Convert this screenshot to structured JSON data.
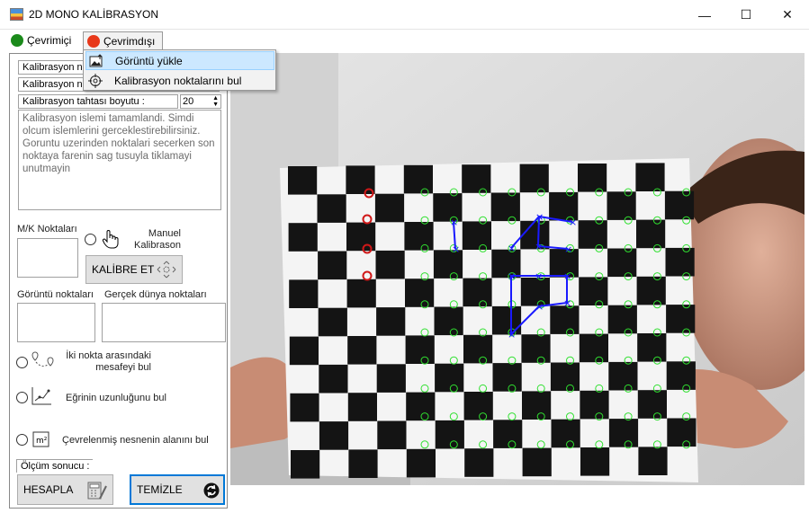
{
  "window": {
    "title": "2D MONO KALİBRASYON",
    "controls": [
      "—",
      "☐",
      "✕"
    ]
  },
  "menu": {
    "online": {
      "label": "Çevrimiçi",
      "color": "#1b8a1b"
    },
    "offline": {
      "label": "Çevrimdışı",
      "color": "#e8381a"
    },
    "dropdown": [
      {
        "label": "Görüntü yükle",
        "icon": "image-upload-icon"
      },
      {
        "label": "Kalibrasyon noktalarını bul",
        "icon": "target-icon"
      }
    ]
  },
  "panel": {
    "field1": "Kalibrasyon nok",
    "field2": "Kalibrasyon no",
    "board_size_label": "Kalibrasyon tahtası boyutu :",
    "board_size_value": "20",
    "info_text": "Kalibrasyon islemi tamamlandi. Simdi olcum islemlerini gerceklestirebilirsiniz. Goruntu uzerinden noktalari secerken son noktaya farenin sag tusuyla tiklamayi unutmayin",
    "mk_points_label": "M/K Noktaları",
    "manual_calib_label": "Manuel Kalibrason",
    "calibrate_button": "KALİBRE ET",
    "image_points_label": "Görüntü noktaları",
    "world_points_label": "Gerçek dünya noktaları",
    "distance_option": "İki nokta arasındaki mesafeyi bul",
    "curve_option": "Eğrinin uzunluğunu bul",
    "area_option": "Çevrelenmiş nesnenin alanını bul",
    "result_label": "Ölçüm sonucu :",
    "calculate_button": "HESAPLA",
    "clear_button": "TEMİZLE"
  },
  "colors": {
    "detected_marker": "#30e030",
    "selected_marker": "#d01818",
    "measure_path": "#1a1aff",
    "accent": "#0078d7"
  }
}
